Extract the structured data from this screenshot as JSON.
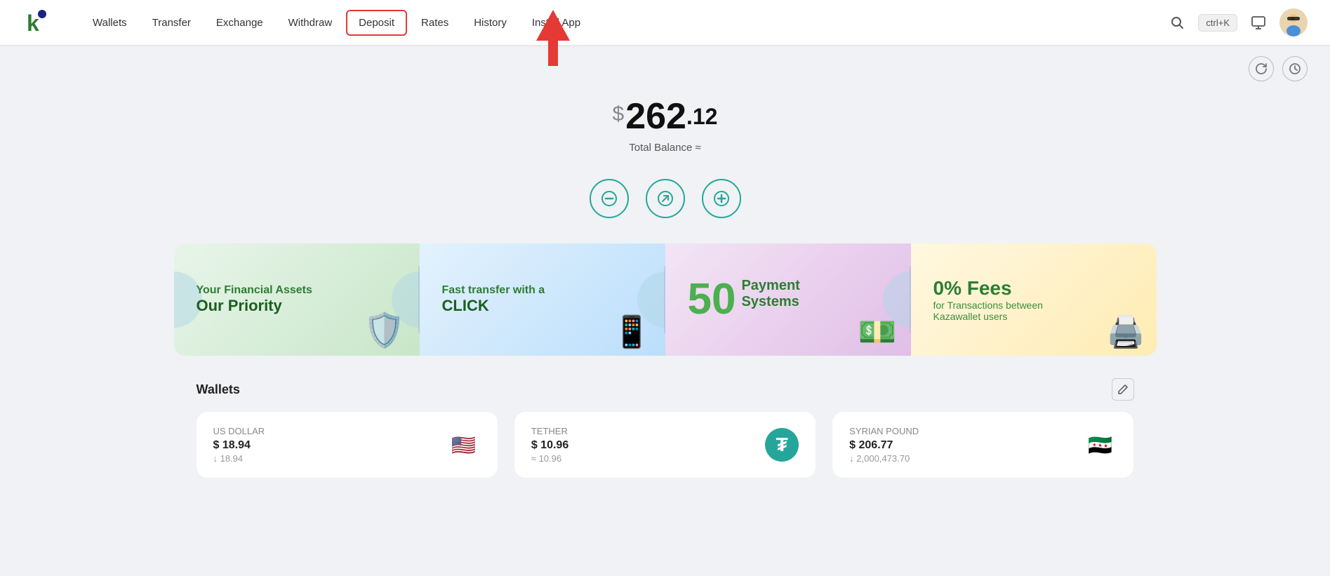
{
  "navbar": {
    "logo_text": "K",
    "links": [
      {
        "label": "Wallets",
        "id": "wallets"
      },
      {
        "label": "Transfer",
        "id": "transfer"
      },
      {
        "label": "Exchange",
        "id": "exchange"
      },
      {
        "label": "Withdraw",
        "id": "withdraw"
      },
      {
        "label": "Deposit",
        "id": "deposit"
      },
      {
        "label": "Rates",
        "id": "rates"
      },
      {
        "label": "History",
        "id": "history"
      },
      {
        "label": "Install App",
        "id": "install"
      }
    ],
    "shortcut_label": "ctrl+K"
  },
  "balance": {
    "dollar_sign": "$",
    "integer": "262",
    "dot": ".",
    "decimal": "12",
    "label": "Total Balance ≈"
  },
  "action_buttons": [
    {
      "id": "withdraw",
      "icon": "−",
      "label": "Withdraw"
    },
    {
      "id": "transfer",
      "icon": "↗",
      "label": "Transfer"
    },
    {
      "id": "deposit",
      "icon": "+",
      "label": "Deposit"
    }
  ],
  "promo": [
    {
      "id": "security",
      "title": "Your Financial Assets",
      "subtitle": "Our Priority"
    },
    {
      "id": "transfer",
      "title": "Fast transfer with a",
      "subtitle": "CLICK"
    },
    {
      "id": "payment",
      "big": "50",
      "side_line1": "Payment",
      "side_line2": "Systems"
    },
    {
      "id": "fees",
      "title_line1": "0% Fees",
      "title_line2": "for Transactions between",
      "title_line3": "Kazawallet users"
    }
  ],
  "wallets_section": {
    "title": "Wallets",
    "cards": [
      {
        "name": "US DOLLAR",
        "usd": "$ 18.94",
        "native": "↓ 18.94",
        "flag_emoji": "🇺🇸",
        "flag_type": "us"
      },
      {
        "name": "TETHER",
        "usd": "$ 10.96",
        "native": "≈ 10.96",
        "flag_emoji": "₮",
        "flag_type": "usdt"
      },
      {
        "name": "SYRIAN POUND",
        "usd": "$ 206.77",
        "native": "↓ 2,000,473.70",
        "flag_emoji": "🇸🇾",
        "flag_type": "sy"
      }
    ]
  },
  "icons": {
    "search": "🔍",
    "refresh": "↻",
    "history_clock": "🕐",
    "edit": "✎",
    "screen": "⬜",
    "avatar": "👤"
  }
}
